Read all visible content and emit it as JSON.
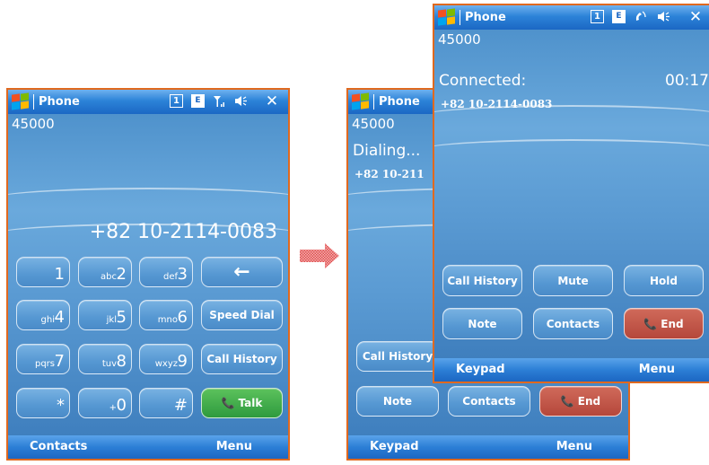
{
  "title_bar": {
    "app_title": "Phone",
    "indicator_1": "1",
    "indicator_e": "E"
  },
  "carrier": "45000",
  "keypad_screen": {
    "entered_number": "+82 10-2114-0083",
    "keys": [
      {
        "letters": "",
        "digit": "1"
      },
      {
        "letters": "abc",
        "digit": "2"
      },
      {
        "letters": "def",
        "digit": "3"
      },
      {
        "letters": "ghi",
        "digit": "4"
      },
      {
        "letters": "jkl",
        "digit": "5"
      },
      {
        "letters": "mno",
        "digit": "6"
      },
      {
        "letters": "pqrs",
        "digit": "7"
      },
      {
        "letters": "tuv",
        "digit": "8"
      },
      {
        "letters": "wxyz",
        "digit": "9"
      },
      {
        "letters": "",
        "digit": "*"
      },
      {
        "letters": "+",
        "digit": "0"
      },
      {
        "letters": "",
        "digit": "#"
      }
    ],
    "backspace": "←",
    "speed_dial": "Speed Dial",
    "call_history": "Call History",
    "talk": "Talk",
    "soft_left": "Contacts",
    "soft_right": "Menu"
  },
  "dialing_screen": {
    "status": "Dialing...",
    "number": "+82 10-211",
    "call_history": "Call History",
    "note": "Note",
    "contacts": "Contacts",
    "end": "End",
    "soft_left": "Keypad",
    "soft_right": "Menu"
  },
  "connected_screen": {
    "status": "Connected:",
    "timer": "00:17",
    "number": "+82 10-2114-0083",
    "call_history": "Call History",
    "mute": "Mute",
    "hold": "Hold",
    "note": "Note",
    "contacts": "Contacts",
    "end": "End",
    "soft_left": "Keypad",
    "soft_right": "Menu"
  },
  "colors": {
    "frame": "#e0691f",
    "title_bar": "#1b67c4",
    "talk": "#2e9a3e",
    "end": "#b5473b"
  }
}
